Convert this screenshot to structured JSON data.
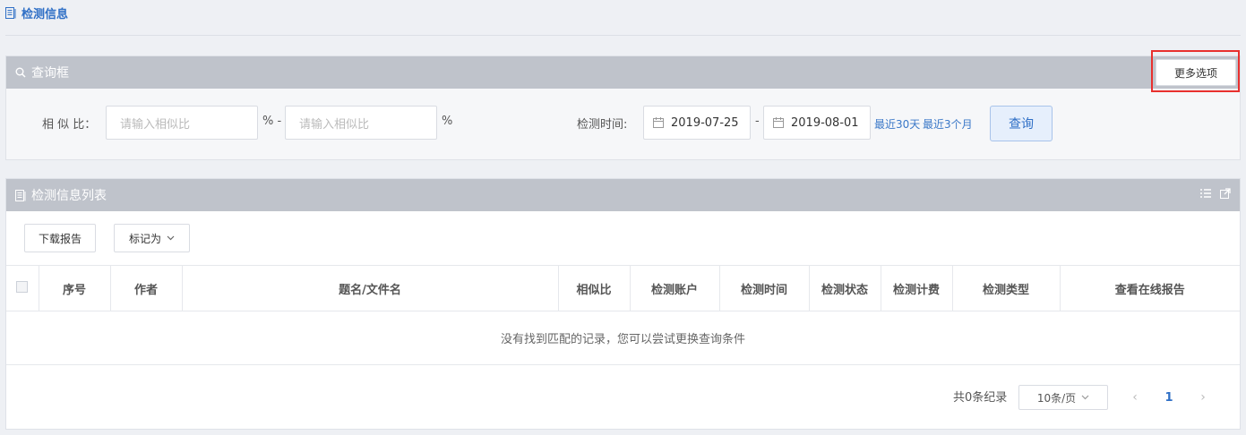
{
  "page": {
    "title": "检测信息"
  },
  "search": {
    "title": "查询框",
    "more_options_label": "更多选项",
    "similarity_label": "相 似 比：",
    "similarity_from_placeholder": "请输入相似比",
    "similarity_to_placeholder": "请输入相似比",
    "percent_dash": "% -",
    "percent": "%",
    "time_label": "检测时间:",
    "date_from": "2019-07-25",
    "date_sep": "-",
    "date_to": "2019-08-01",
    "quick_30": "最近30天",
    "quick_3m": "最近3个月",
    "query_label": "查询"
  },
  "list": {
    "title": "检测信息列表",
    "download_label": "下载报告",
    "mark_label": "标记为",
    "columns": [
      "序号",
      "作者",
      "题名/文件名",
      "相似比",
      "检测账户",
      "检测时间",
      "检测状态",
      "检测计费",
      "检测类型",
      "查看在线报告"
    ],
    "empty_text": "没有找到匹配的记录，您可以尝试更换查询条件"
  },
  "pagination": {
    "total": "共0条纪录",
    "page_size": "10条/页",
    "prev": "‹",
    "current": "1",
    "next": "›"
  },
  "colors": {
    "accent": "#2f6fc6",
    "panel_header": "#bfc3cb",
    "highlight": "#e8302e"
  }
}
